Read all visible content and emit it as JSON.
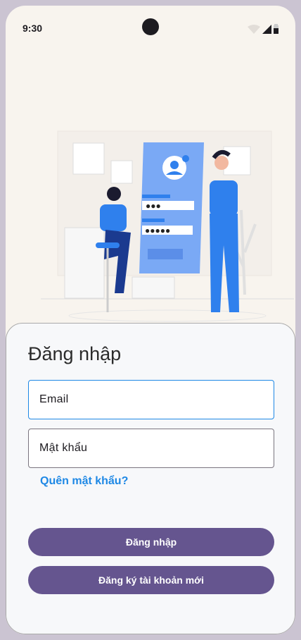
{
  "status_bar": {
    "time": "9:30",
    "icons": [
      "wifi-icon",
      "signal-icon",
      "battery-icon"
    ]
  },
  "login": {
    "title": "Đăng nhập",
    "email_placeholder": "Email",
    "password_placeholder": "Mật khẩu",
    "forgot_password": "Quên mật khẩu?",
    "login_button": "Đăng nhập",
    "register_button": "Đăng ký tài khoản mới"
  },
  "colors": {
    "primary": "#65558f",
    "link": "#1e88e5",
    "accent_illustration": "#2f80ed"
  }
}
